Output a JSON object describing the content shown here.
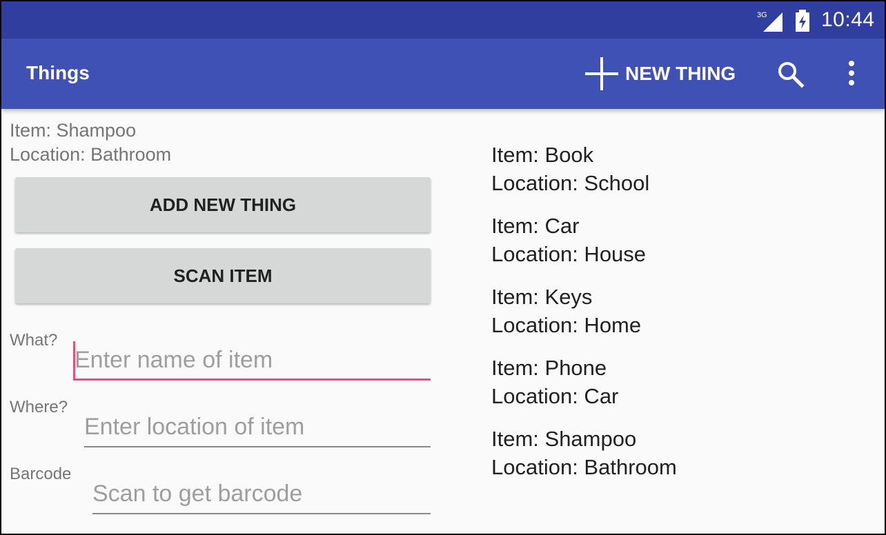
{
  "status_bar": {
    "network": "3G",
    "time": "10:44"
  },
  "app_bar": {
    "title": "Things",
    "new_thing_label": "NEW THING",
    "icons": [
      "plus-icon",
      "search-icon",
      "more-vert-icon"
    ]
  },
  "last_item": {
    "item_line": "Item: Shampoo",
    "location_line": "Location: Bathroom"
  },
  "buttons": {
    "add_new_thing": "ADD NEW THING",
    "scan_item": "SCAN ITEM"
  },
  "form": {
    "what": {
      "label": "What?",
      "placeholder": "Enter name of item"
    },
    "where": {
      "label": "Where?",
      "placeholder": "Enter location of item"
    },
    "barcode": {
      "label": "Barcode",
      "placeholder": "Scan to get barcode"
    }
  },
  "things": [
    {
      "item": "Item: Book",
      "location": "Location: School"
    },
    {
      "item": "Item: Car",
      "location": "Location: House"
    },
    {
      "item": "Item: Keys",
      "location": "Location: Home"
    },
    {
      "item": "Item: Phone",
      "location": "Location: Car"
    },
    {
      "item": "Item: Shampoo",
      "location": "Location: Bathroom"
    }
  ],
  "colors": {
    "status_bar": "#303f9f",
    "app_bar": "#3f51b5",
    "accent": "#ff4081",
    "button": "#d6d7d7"
  }
}
